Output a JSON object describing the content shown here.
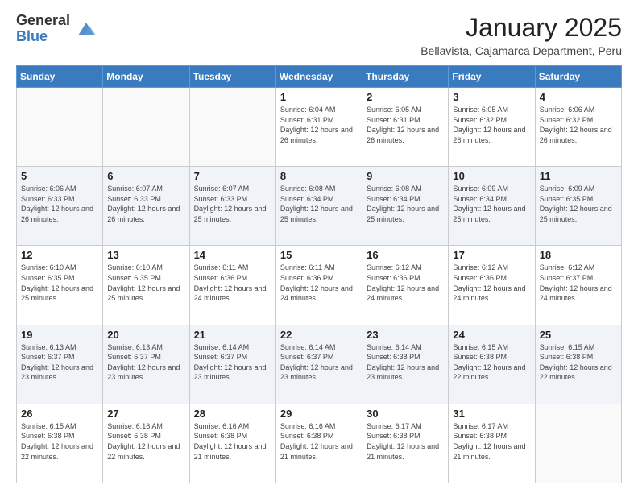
{
  "logo": {
    "general": "General",
    "blue": "Blue"
  },
  "title": "January 2025",
  "subtitle": "Bellavista, Cajamarca Department, Peru",
  "days_of_week": [
    "Sunday",
    "Monday",
    "Tuesday",
    "Wednesday",
    "Thursday",
    "Friday",
    "Saturday"
  ],
  "weeks": [
    [
      {
        "day": "",
        "info": ""
      },
      {
        "day": "",
        "info": ""
      },
      {
        "day": "",
        "info": ""
      },
      {
        "day": "1",
        "info": "Sunrise: 6:04 AM\nSunset: 6:31 PM\nDaylight: 12 hours and 26 minutes."
      },
      {
        "day": "2",
        "info": "Sunrise: 6:05 AM\nSunset: 6:31 PM\nDaylight: 12 hours and 26 minutes."
      },
      {
        "day": "3",
        "info": "Sunrise: 6:05 AM\nSunset: 6:32 PM\nDaylight: 12 hours and 26 minutes."
      },
      {
        "day": "4",
        "info": "Sunrise: 6:06 AM\nSunset: 6:32 PM\nDaylight: 12 hours and 26 minutes."
      }
    ],
    [
      {
        "day": "5",
        "info": "Sunrise: 6:06 AM\nSunset: 6:33 PM\nDaylight: 12 hours and 26 minutes."
      },
      {
        "day": "6",
        "info": "Sunrise: 6:07 AM\nSunset: 6:33 PM\nDaylight: 12 hours and 26 minutes."
      },
      {
        "day": "7",
        "info": "Sunrise: 6:07 AM\nSunset: 6:33 PM\nDaylight: 12 hours and 25 minutes."
      },
      {
        "day": "8",
        "info": "Sunrise: 6:08 AM\nSunset: 6:34 PM\nDaylight: 12 hours and 25 minutes."
      },
      {
        "day": "9",
        "info": "Sunrise: 6:08 AM\nSunset: 6:34 PM\nDaylight: 12 hours and 25 minutes."
      },
      {
        "day": "10",
        "info": "Sunrise: 6:09 AM\nSunset: 6:34 PM\nDaylight: 12 hours and 25 minutes."
      },
      {
        "day": "11",
        "info": "Sunrise: 6:09 AM\nSunset: 6:35 PM\nDaylight: 12 hours and 25 minutes."
      }
    ],
    [
      {
        "day": "12",
        "info": "Sunrise: 6:10 AM\nSunset: 6:35 PM\nDaylight: 12 hours and 25 minutes."
      },
      {
        "day": "13",
        "info": "Sunrise: 6:10 AM\nSunset: 6:35 PM\nDaylight: 12 hours and 25 minutes."
      },
      {
        "day": "14",
        "info": "Sunrise: 6:11 AM\nSunset: 6:36 PM\nDaylight: 12 hours and 24 minutes."
      },
      {
        "day": "15",
        "info": "Sunrise: 6:11 AM\nSunset: 6:36 PM\nDaylight: 12 hours and 24 minutes."
      },
      {
        "day": "16",
        "info": "Sunrise: 6:12 AM\nSunset: 6:36 PM\nDaylight: 12 hours and 24 minutes."
      },
      {
        "day": "17",
        "info": "Sunrise: 6:12 AM\nSunset: 6:36 PM\nDaylight: 12 hours and 24 minutes."
      },
      {
        "day": "18",
        "info": "Sunrise: 6:12 AM\nSunset: 6:37 PM\nDaylight: 12 hours and 24 minutes."
      }
    ],
    [
      {
        "day": "19",
        "info": "Sunrise: 6:13 AM\nSunset: 6:37 PM\nDaylight: 12 hours and 23 minutes."
      },
      {
        "day": "20",
        "info": "Sunrise: 6:13 AM\nSunset: 6:37 PM\nDaylight: 12 hours and 23 minutes."
      },
      {
        "day": "21",
        "info": "Sunrise: 6:14 AM\nSunset: 6:37 PM\nDaylight: 12 hours and 23 minutes."
      },
      {
        "day": "22",
        "info": "Sunrise: 6:14 AM\nSunset: 6:37 PM\nDaylight: 12 hours and 23 minutes."
      },
      {
        "day": "23",
        "info": "Sunrise: 6:14 AM\nSunset: 6:38 PM\nDaylight: 12 hours and 23 minutes."
      },
      {
        "day": "24",
        "info": "Sunrise: 6:15 AM\nSunset: 6:38 PM\nDaylight: 12 hours and 22 minutes."
      },
      {
        "day": "25",
        "info": "Sunrise: 6:15 AM\nSunset: 6:38 PM\nDaylight: 12 hours and 22 minutes."
      }
    ],
    [
      {
        "day": "26",
        "info": "Sunrise: 6:15 AM\nSunset: 6:38 PM\nDaylight: 12 hours and 22 minutes."
      },
      {
        "day": "27",
        "info": "Sunrise: 6:16 AM\nSunset: 6:38 PM\nDaylight: 12 hours and 22 minutes."
      },
      {
        "day": "28",
        "info": "Sunrise: 6:16 AM\nSunset: 6:38 PM\nDaylight: 12 hours and 21 minutes."
      },
      {
        "day": "29",
        "info": "Sunrise: 6:16 AM\nSunset: 6:38 PM\nDaylight: 12 hours and 21 minutes."
      },
      {
        "day": "30",
        "info": "Sunrise: 6:17 AM\nSunset: 6:38 PM\nDaylight: 12 hours and 21 minutes."
      },
      {
        "day": "31",
        "info": "Sunrise: 6:17 AM\nSunset: 6:38 PM\nDaylight: 12 hours and 21 minutes."
      },
      {
        "day": "",
        "info": ""
      }
    ]
  ]
}
